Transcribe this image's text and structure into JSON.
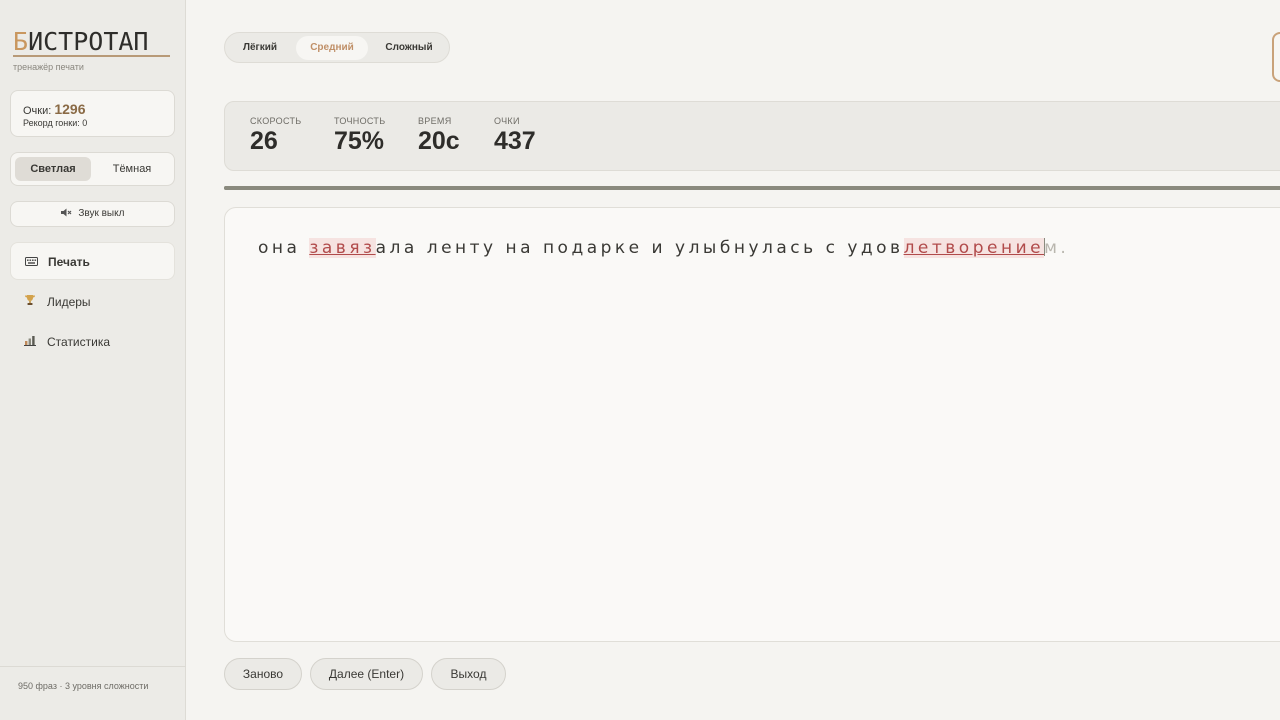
{
  "sidebar": {
    "logo_first": "Б",
    "logo_rest": "ИСТРОТАП",
    "subtitle": "тренажёр печати",
    "score_label": "Очки: ",
    "score_value": "1296",
    "record_label": "Рекорд гонки: 0",
    "theme": {
      "light": "Светлая",
      "dark": "Тёмная",
      "active": "light"
    },
    "sound": {
      "icon": "speaker-muted-icon",
      "label": "Звук выкл"
    },
    "nav": [
      {
        "label": "Печать",
        "icon": "keyboard-icon",
        "active": true
      },
      {
        "label": "Лидеры",
        "icon": "trophy-icon",
        "active": false
      },
      {
        "label": "Статистика",
        "icon": "bar-chart-icon",
        "active": false
      }
    ],
    "footer": "950 фраз · 3 уровня сложности"
  },
  "difficulty": {
    "options": [
      "Лёгкий",
      "Средний",
      "Сложный"
    ],
    "active": "Средний"
  },
  "stats": [
    {
      "label": "СКОРОСТЬ",
      "value": "26"
    },
    {
      "label": "ТОЧНОСТЬ",
      "value": "75%"
    },
    {
      "label": "ВРЕМЯ",
      "value": "20с"
    },
    {
      "label": "ОЧКИ",
      "value": "437"
    }
  ],
  "phrase": {
    "p1": "она ",
    "err1": "завяз",
    "p2": "ала ленту на подарке и улыбнулась с удов",
    "err2": "летворение",
    "rest": "м."
  },
  "actions": {
    "restart": "Заново",
    "next": "Далее (Enter)",
    "exit": "Выход"
  },
  "colors": {
    "accent": "#c09068",
    "error": "#b14b4b",
    "score": "#8a6a45"
  }
}
